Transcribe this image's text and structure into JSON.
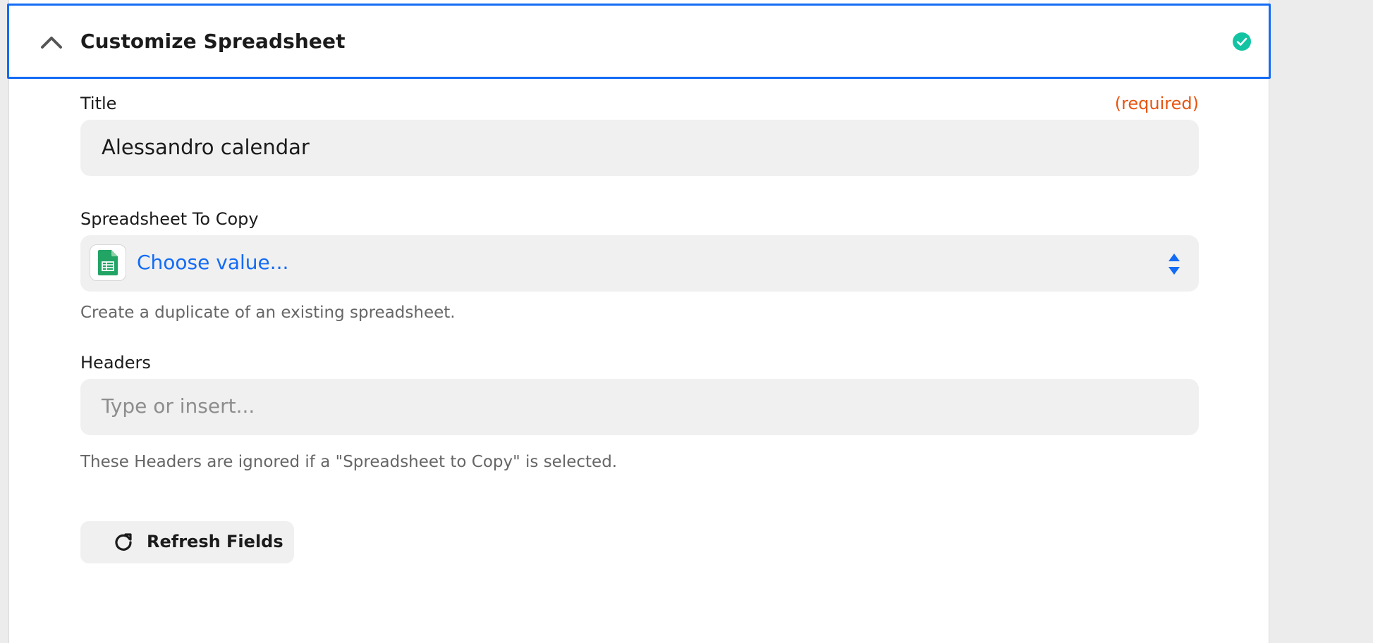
{
  "section": {
    "title": "Customize Spreadsheet",
    "status": "complete"
  },
  "fields": {
    "title": {
      "label": "Title",
      "required_label": "(required)",
      "value": "Alessandro calendar"
    },
    "spreadsheet_to_copy": {
      "label": "Spreadsheet To Copy",
      "placeholder": "Choose value...",
      "help": "Create a duplicate of an existing spreadsheet.",
      "app_icon": "google-sheets-icon"
    },
    "headers": {
      "label": "Headers",
      "placeholder": "Type or insert...",
      "help": "These Headers are ignored if a \"Spreadsheet to Copy\" is selected."
    }
  },
  "actions": {
    "refresh_label": "Refresh Fields"
  },
  "colors": {
    "accent": "#136bf5",
    "success": "#13c4a3",
    "required": "#e8540f",
    "sheets_green": "#21a464"
  }
}
